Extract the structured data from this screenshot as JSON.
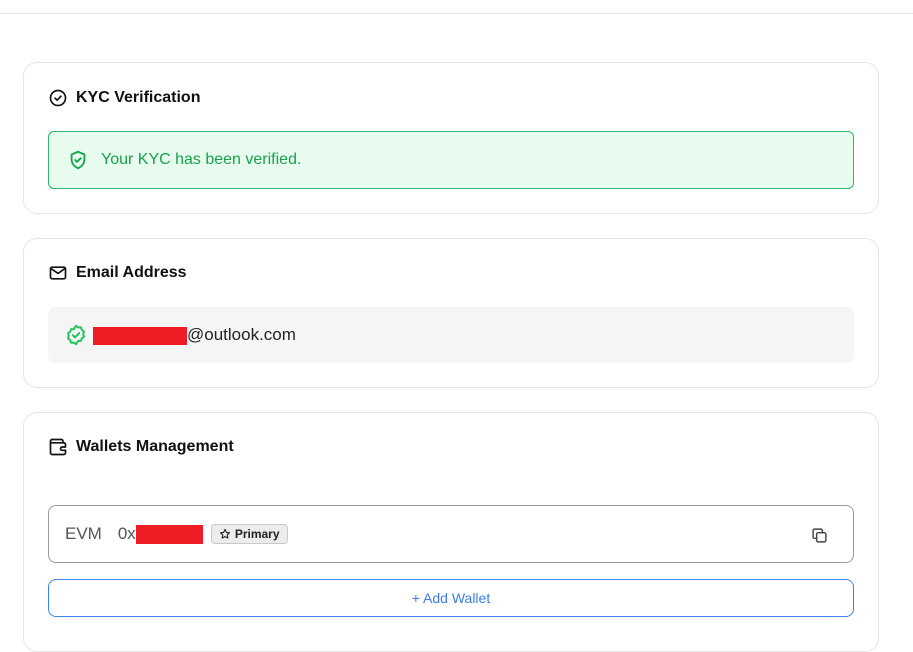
{
  "kyc": {
    "title": "KYC Verification",
    "icon": "check-circle-icon",
    "status_text": "Your KYC has been verified.",
    "status_icon": "shield-check-icon",
    "status_color": "#16a34a"
  },
  "email": {
    "title": "Email Address",
    "icon": "mail-icon",
    "verified_icon": "badge-check-icon",
    "domain": "@outlook.com"
  },
  "wallets": {
    "title": "Wallets Management",
    "icon": "wallet-icon",
    "items": [
      {
        "chain": "EVM",
        "address_prefix": "0x",
        "badge": "Primary",
        "badge_icon": "star-icon",
        "copy_icon": "copy-icon"
      }
    ],
    "add_label": "+ Add Wallet",
    "accent": "#3b82f6"
  }
}
